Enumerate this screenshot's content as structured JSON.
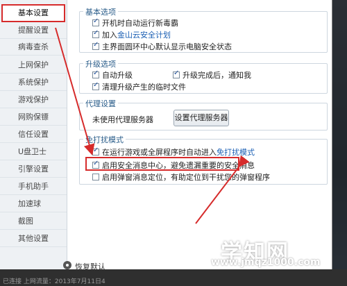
{
  "sidebar": {
    "items": [
      {
        "label": "基本设置",
        "active": true
      },
      {
        "label": "提醒设置"
      },
      {
        "label": "病毒查杀"
      },
      {
        "label": "上网保护"
      },
      {
        "label": "系统保护"
      },
      {
        "label": "游戏保护"
      },
      {
        "label": "网购保镖"
      },
      {
        "label": "信任设置"
      },
      {
        "label": "U盘卫士"
      },
      {
        "label": "引擎设置"
      },
      {
        "label": "手机助手"
      },
      {
        "label": "加速球"
      },
      {
        "label": "截图"
      },
      {
        "label": "其他设置"
      }
    ],
    "restore_label": "恢复默认"
  },
  "sections": {
    "basic": {
      "title": "基本选项",
      "opt1": "开机时自动运行新毒霸",
      "opt2_prefix": "加入",
      "opt2_link": "金山云安全计划",
      "opt3": "主界面圆环中心默认显示电脑安全状态"
    },
    "upgrade": {
      "title": "升级选项",
      "opt1": "自动升级",
      "opt2": "升级完成后，通知我",
      "opt3": "清理升级产生的临时文件"
    },
    "proxy": {
      "title": "代理设置",
      "status": "未使用代理服务器",
      "button": "设置代理服务器"
    },
    "nodisturb": {
      "title": "免打扰模式",
      "opt1_prefix": "在运行游戏或全屏程序时自动进入",
      "opt1_link": "免打扰模式",
      "opt2": "启用安全消息中心，避免遗漏重要的安全消息",
      "opt3": "启用弹窗消息定位，有助定位到干扰您的弹窗程序"
    }
  },
  "watermark": {
    "title": "学知网",
    "url": "www.jmqz1000.com"
  },
  "background_text": "已连接  上网流量：2013年7月11日4",
  "colors": {
    "highlight": "#d62b2b",
    "accent": "#2a5d8a",
    "link": "#1a5fb4"
  }
}
